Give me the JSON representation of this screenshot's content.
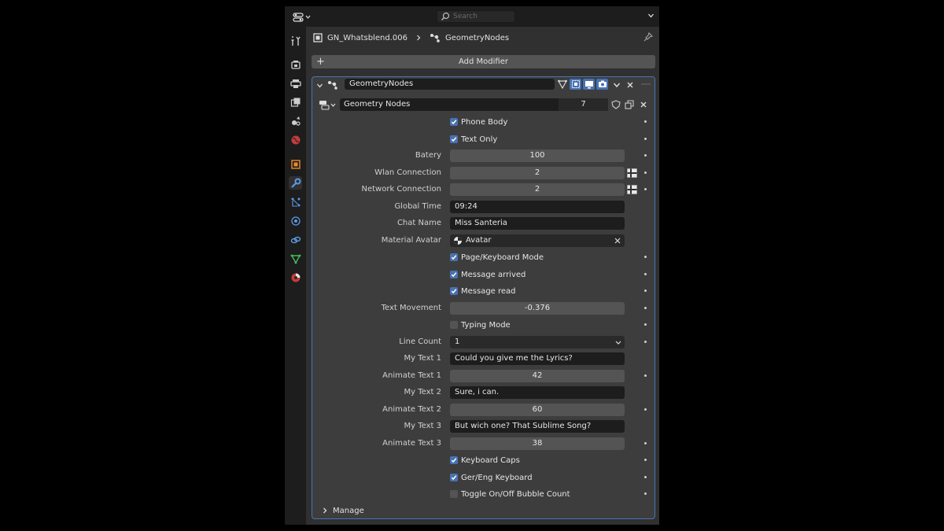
{
  "topbar": {
    "search_placeholder": "Search"
  },
  "header": {
    "object_name": "GN_Whatsblend.006",
    "modifier_crumb": "GeometryNodes"
  },
  "add_modifier": {
    "label": "Add Modifier"
  },
  "modifier": {
    "name": "GeometryNodes",
    "node_group": "Geometry Nodes",
    "user_count": "7"
  },
  "properties": [
    {
      "type": "check",
      "label": "Phone Body",
      "checked": true,
      "dot": true
    },
    {
      "type": "check",
      "label": "Text Only",
      "checked": true,
      "dot": true
    },
    {
      "type": "num",
      "label": "Batery",
      "value": "100",
      "dot": true
    },
    {
      "type": "num",
      "label": "Wlan Connection",
      "value": "2",
      "dot": true,
      "flag": true
    },
    {
      "type": "num",
      "label": "Network Connection",
      "value": "2",
      "dot": true,
      "flag": true
    },
    {
      "type": "txt",
      "label": "Global Time",
      "value": "09:24"
    },
    {
      "type": "txt",
      "label": "Chat Name",
      "value": "Miss Santeria"
    },
    {
      "type": "obj",
      "label": "Material Avatar",
      "value": "Avatar"
    },
    {
      "type": "check",
      "label": "Page/Keyboard Mode",
      "checked": true,
      "dot": true
    },
    {
      "type": "check",
      "label": "Message arrived",
      "checked": true,
      "dot": true
    },
    {
      "type": "check",
      "label": "Message read",
      "checked": true,
      "dot": true
    },
    {
      "type": "num",
      "label": "Text Movement",
      "value": "-0.376",
      "dot": true
    },
    {
      "type": "check",
      "label": "Typing Mode",
      "checked": false,
      "dot": true
    },
    {
      "type": "sel",
      "label": "Line Count",
      "value": "1",
      "dot": true
    },
    {
      "type": "txt",
      "label": "My Text 1",
      "value": "Could you give me the Lyrics?"
    },
    {
      "type": "num",
      "label": "Animate Text 1",
      "value": "42",
      "dot": true
    },
    {
      "type": "txt",
      "label": "My Text 2",
      "value": "Sure, i can."
    },
    {
      "type": "num",
      "label": "Animate Text 2",
      "value": "60",
      "dot": true
    },
    {
      "type": "txt",
      "label": "My Text 3",
      "value": "But wich one? That Sublime Song?"
    },
    {
      "type": "num",
      "label": "Animate Text 3",
      "value": "38",
      "dot": true
    },
    {
      "type": "check",
      "label": "Keyboard Caps",
      "checked": true,
      "dot": true
    },
    {
      "type": "check",
      "label": "Ger/Eng Keyboard",
      "checked": true,
      "dot": true
    },
    {
      "type": "check",
      "label": "Toggle On/Off Bubble Count",
      "checked": false,
      "dot": true
    }
  ],
  "manage": {
    "label": "Manage"
  },
  "sidebar_tabs": [
    "tool-icon",
    "render-icon",
    "output-icon",
    "view-layer-icon",
    "scene-icon",
    "world-icon",
    "object-icon",
    "modifier-icon",
    "particles-icon",
    "physics-icon",
    "constraints-icon",
    "data-icon",
    "material-icon"
  ],
  "colors": {
    "accent": "#4772b3",
    "panel_border": "#4b74b5",
    "background": "#303030"
  }
}
